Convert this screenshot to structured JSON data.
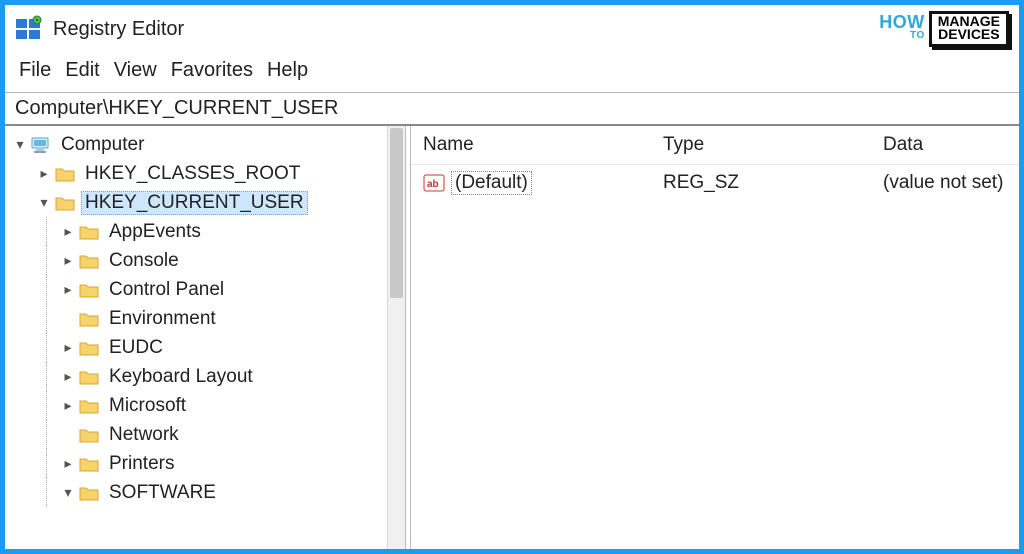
{
  "window": {
    "title": "Registry Editor"
  },
  "watermark": {
    "how": "HOW",
    "to": "TO",
    "line1": "MANAGE",
    "line2": "DEVICES"
  },
  "menu": {
    "file": "File",
    "edit": "Edit",
    "view": "View",
    "favorites": "Favorites",
    "help": "Help"
  },
  "address": {
    "path": "Computer\\HKEY_CURRENT_USER"
  },
  "tree": {
    "root": "Computer",
    "hkcr": "HKEY_CLASSES_ROOT",
    "hkcu": "HKEY_CURRENT_USER",
    "children": {
      "appevents": "AppEvents",
      "console": "Console",
      "controlpanel": "Control Panel",
      "environment": "Environment",
      "eudc": "EUDC",
      "keyboard": "Keyboard Layout",
      "microsoft": "Microsoft",
      "network": "Network",
      "printers": "Printers",
      "software": "SOFTWARE"
    }
  },
  "columns": {
    "name": "Name",
    "type": "Type",
    "data": "Data"
  },
  "values": [
    {
      "name": "(Default)",
      "type": "REG_SZ",
      "data": "(value not set)"
    }
  ]
}
